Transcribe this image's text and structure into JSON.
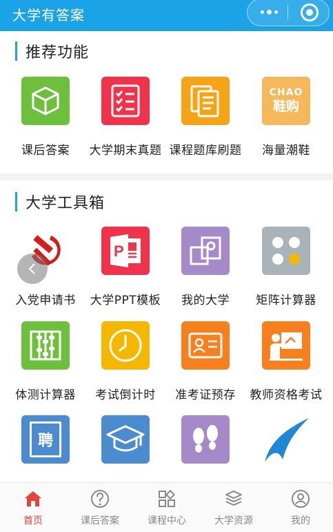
{
  "header": {
    "title": "大学有答案"
  },
  "sections": [
    {
      "title": "推荐功能"
    },
    {
      "title": "大学工具箱"
    }
  ],
  "recommend": [
    {
      "label": "课后答案",
      "color": "#6cc03c",
      "icon": "cube-icon"
    },
    {
      "label": "大学期末真题",
      "color": "#f0334a",
      "icon": "checklist-icon"
    },
    {
      "label": "课程题库刷题",
      "color": "#f7a316",
      "icon": "documents-icon"
    },
    {
      "label": "海量潮鞋",
      "color": "#f5b85a",
      "icon": "chao-logo",
      "logo_top": "CHAO",
      "logo_bottom": "鞋购"
    }
  ],
  "toolbox": [
    {
      "label": "入党申请书",
      "color": "#ffffff",
      "icon": "hammer-sickle-icon"
    },
    {
      "label": "大学PPT模板",
      "color": "#f0334a",
      "icon": "powerpoint-icon"
    },
    {
      "label": "我的大学",
      "color": "#a48ac9",
      "icon": "building-icon"
    },
    {
      "label": "矩阵计算器",
      "color": "#a9b3ba",
      "icon": "matrix-dots-icon"
    },
    {
      "label": "体测计算器",
      "color": "#6cc03c",
      "icon": "abacus-icon"
    },
    {
      "label": "考试倒计时",
      "color": "#f5b800",
      "icon": "clock-icon"
    },
    {
      "label": "准考证预存",
      "color": "#f77f1e",
      "icon": "id-card-icon"
    },
    {
      "label": "教师资格考试",
      "color": "#f77f1e",
      "icon": "teacher-board-icon"
    },
    {
      "label": "",
      "color": "#4b8cd0",
      "icon": "hire-icon",
      "glyph": "聘"
    },
    {
      "label": "",
      "color": "#4b8cd0",
      "icon": "graduation-cap-icon"
    },
    {
      "label": "",
      "color": "#a48ac9",
      "icon": "footprints-icon"
    },
    {
      "label": "",
      "color": "#ffffff",
      "icon": "swoosh-logo"
    }
  ],
  "tabbar": [
    {
      "label": "首页",
      "icon": "home-icon",
      "active": true
    },
    {
      "label": "课后答案",
      "icon": "question-icon",
      "active": false
    },
    {
      "label": "课程中心",
      "icon": "grid-icon",
      "active": false
    },
    {
      "label": "大学资源",
      "icon": "books-icon",
      "active": false
    },
    {
      "label": "我的",
      "icon": "profile-icon",
      "active": false
    }
  ],
  "colors": {
    "primary": "#1aa3e6",
    "active_tab": "#e8423c",
    "inactive_tab": "#888888"
  }
}
